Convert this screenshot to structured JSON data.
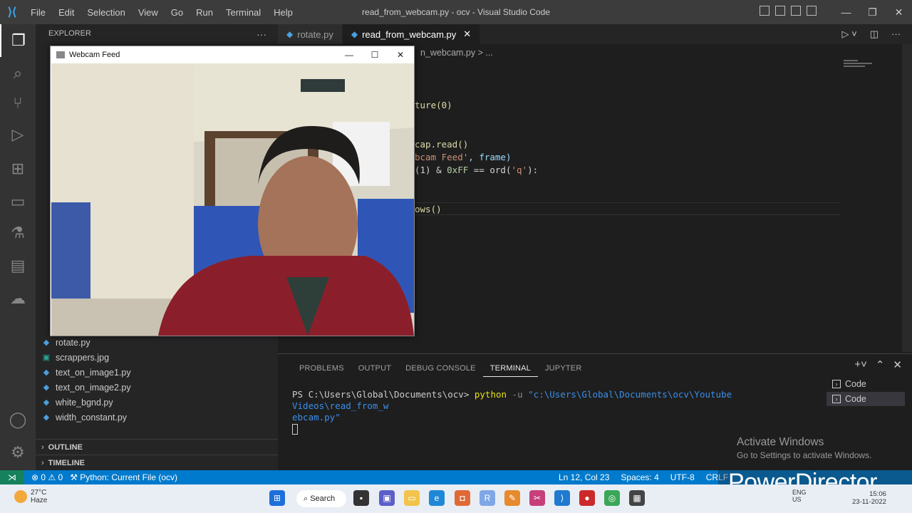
{
  "titlebar": {
    "menu": [
      "File",
      "Edit",
      "Selection",
      "View",
      "Go",
      "Run",
      "Terminal",
      "Help"
    ],
    "window_title": "read_from_webcam.py - ocv - Visual Studio Code"
  },
  "sidebar": {
    "header": "EXPLORER",
    "files": [
      {
        "name": "rotate.py",
        "icon": "python-icon"
      },
      {
        "name": "scrappers.jpg",
        "icon": "image-icon"
      },
      {
        "name": "text_on_image1.py",
        "icon": "python-icon"
      },
      {
        "name": "text_on_image2.py",
        "icon": "python-icon"
      },
      {
        "name": "white_bgnd.py",
        "icon": "python-icon"
      },
      {
        "name": "width_constant.py",
        "icon": "python-icon"
      }
    ],
    "sections": [
      "OUTLINE",
      "TIMELINE"
    ]
  },
  "editor": {
    "tabs": [
      {
        "label": "rotate.py",
        "active": false
      },
      {
        "label": "read_from_webcam.py",
        "active": true
      }
    ],
    "breadcrumb": "n_webcam.py > ...",
    "code_fragments": {
      "l1": "ture(0)",
      "l2": "cap.read()",
      "l3_str": "bcam Feed'",
      "l3_rest": ", frame)",
      "l4_a": "(1) & ",
      "l4_hex": "0xFF",
      "l4_b": " == ord(",
      "l4_str": "'q'",
      "l4_c": "):",
      "l5": "ows()"
    }
  },
  "panel": {
    "tabs": [
      "PROBLEMS",
      "OUTPUT",
      "DEBUG CONSOLE",
      "TERMINAL",
      "JUPYTER"
    ],
    "active_tab": "TERMINAL",
    "terminal": {
      "prompt": "PS C:\\Users\\Global\\Documents\\ocv> ",
      "command": "python",
      "flag": " -u ",
      "path_line1": "\"c:\\Users\\Global\\Documents\\ocv\\Youtube Videos\\read_from_w",
      "path_line2": "ebcam.py\""
    },
    "terminal_list": [
      "Code",
      "Code"
    ]
  },
  "activate_windows": {
    "line1": "Activate Windows",
    "line2": "Go to Settings to activate Windows."
  },
  "statusbar": {
    "errors": "0",
    "warnings": "0",
    "run_config": "Python: Current File (ocv)",
    "position": "Ln 12, Col 23",
    "spaces": "Spaces: 4",
    "encoding": "UTF-8",
    "eol": "CRLF"
  },
  "watermark": "PowerDirector",
  "webcam_window": {
    "title": "Webcam Feed"
  },
  "taskbar": {
    "weather_temp": "27°C",
    "weather_desc": "Haze",
    "search_label": "Search",
    "lang1": "ENG",
    "lang2": "US",
    "time": "15:06",
    "date": "23-11-2022"
  },
  "colors": {
    "accent": "#007acc",
    "editor_bg": "#1e1e1e",
    "sidebar_bg": "#252526",
    "titlebar_bg": "#3c3c3c"
  }
}
